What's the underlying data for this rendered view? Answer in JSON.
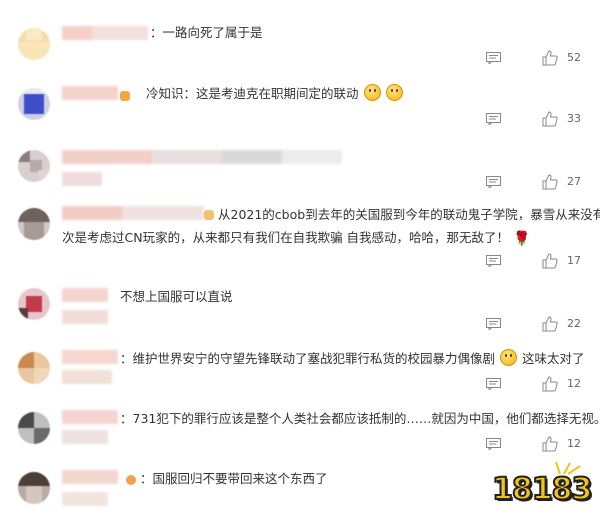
{
  "comments": [
    {
      "text": "：一路向死了属于是",
      "likes": "52"
    },
    {
      "text": "冷知识：这是考迪克在职期间定的联动",
      "likes": "33"
    },
    {
      "text": "",
      "likes": "27"
    },
    {
      "text": "从2021的cbob到去年的关国服到今年的联动鬼子学院，暴雪从来没有一",
      "text2": "次是考虑过CN玩家的，从来都只有我们在自我欺骗 自我感动，哈哈，那无敌了！",
      "likes": "17"
    },
    {
      "text": "不想上国服可以直说",
      "likes": "22"
    },
    {
      "text": "：维护世界安宁的守望先锋联动了塞战犯罪行私货的校园暴力偶像剧",
      "text_after": "这味太对了",
      "likes": "12"
    },
    {
      "text": "：731犯下的罪行应该是整个人类社会都应该抵制的……就因为中国，他们都选择无视。",
      "likes": "12"
    },
    {
      "text": "：国服回归不要带回来这个东西了",
      "likes": ""
    }
  ],
  "watermark": "18183",
  "icons": {
    "reply": "comment-icon",
    "like": "thumbs-up-icon"
  }
}
